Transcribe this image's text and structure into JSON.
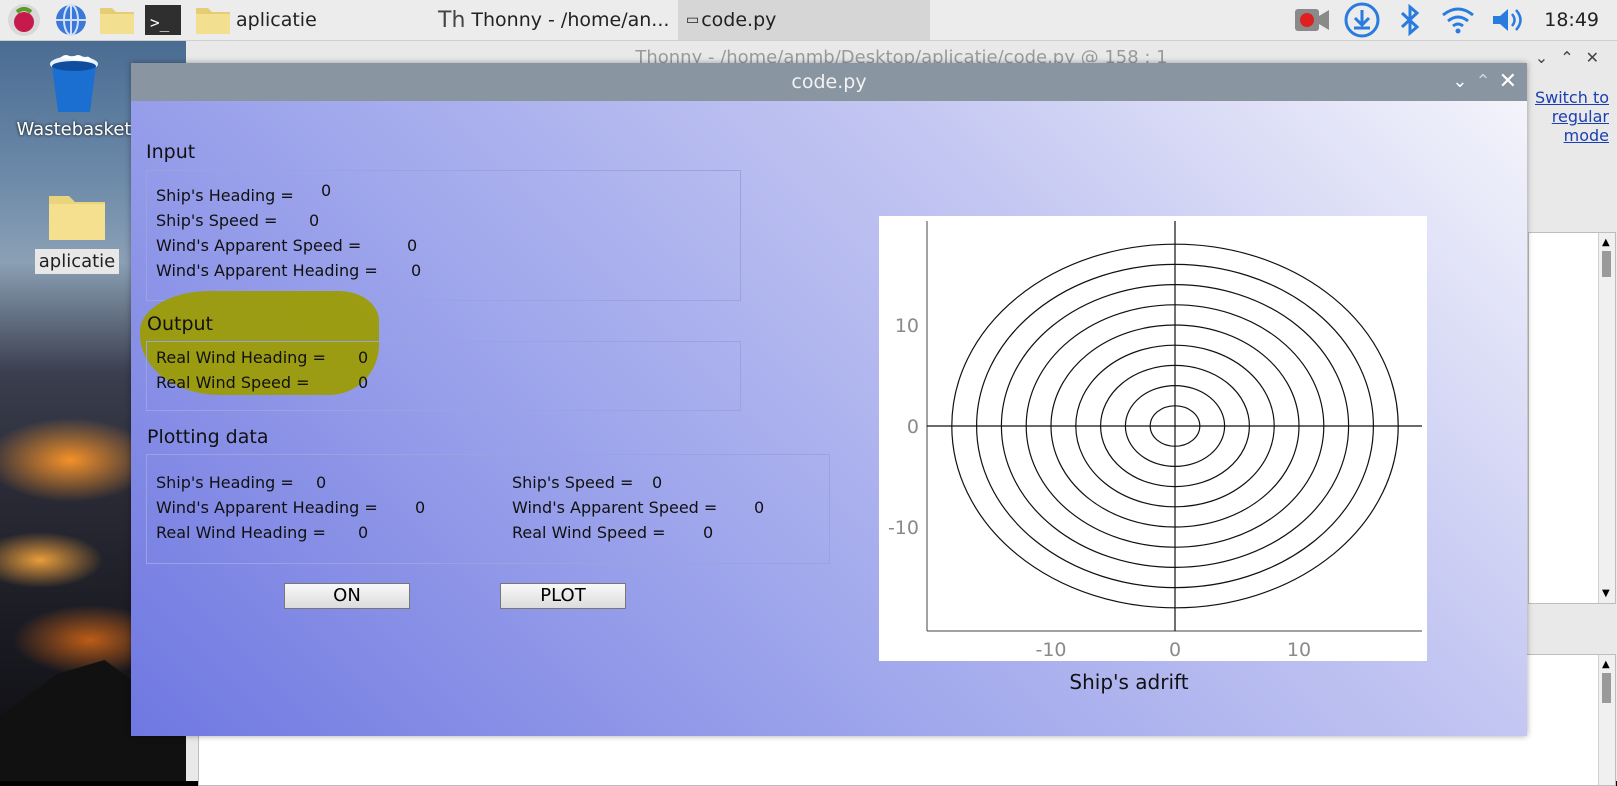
{
  "taskbar": {
    "folder_label": "aplicatie",
    "thonny_label": "Thonny  -  /home/an...",
    "code_label": "code.py",
    "clock": "18:49"
  },
  "desktop": {
    "wastebasket_label": "Wastebasket",
    "folder_label": "aplicatie"
  },
  "thonny": {
    "title": "Thonny  -  /home/anmb/Desktop/aplicatie/code.py  @  158 : 1",
    "switch_mode_link": "Switch to regular mode"
  },
  "dialog": {
    "title": "code.py",
    "input": {
      "title": "Input",
      "rows": [
        {
          "label": "Ship's Heading =",
          "value": "0"
        },
        {
          "label": "Ship's Speed =",
          "value": "0"
        },
        {
          "label": "Wind's Apparent Speed =",
          "value": "0"
        },
        {
          "label": "Wind's Apparent Heading =",
          "value": "0"
        }
      ]
    },
    "output": {
      "title": "Output",
      "rows": [
        {
          "label": "Real Wind Heading =",
          "value": "0"
        },
        {
          "label": "Real Wind Speed =",
          "value": "0"
        }
      ]
    },
    "plotting": {
      "title": "Plotting data",
      "left": [
        {
          "label": "Ship's Heading =",
          "value": "0"
        },
        {
          "label": "Wind's Apparent Heading =",
          "value": "0"
        },
        {
          "label": "Real Wind Heading =",
          "value": "0"
        }
      ],
      "right": [
        {
          "label": "Ship's Speed =",
          "value": "0"
        },
        {
          "label": "Wind's Apparent Speed =",
          "value": "0"
        },
        {
          "label": "Real Wind Speed =",
          "value": "0"
        }
      ]
    },
    "buttons": {
      "on": "ON",
      "plot": "PLOT"
    },
    "plot_caption": "Ship's adrift"
  },
  "colors": {
    "highlight": "#9c9c00",
    "dialog_titlebar": "#8995a0",
    "link": "#1a3fb0"
  },
  "chart_data": {
    "type": "line",
    "title": "Ship's adrift",
    "xlabel": "",
    "ylabel": "",
    "xlim": [
      -20,
      20
    ],
    "ylim": [
      -20,
      20
    ],
    "x_ticks": [
      "-10",
      "0",
      "10"
    ],
    "y_ticks": [
      "10",
      "0",
      "-10"
    ],
    "concentric_circle_radii": [
      2,
      4,
      6,
      8,
      10,
      12,
      14,
      16,
      18
    ],
    "axes_crosshair": true,
    "grid": false
  }
}
